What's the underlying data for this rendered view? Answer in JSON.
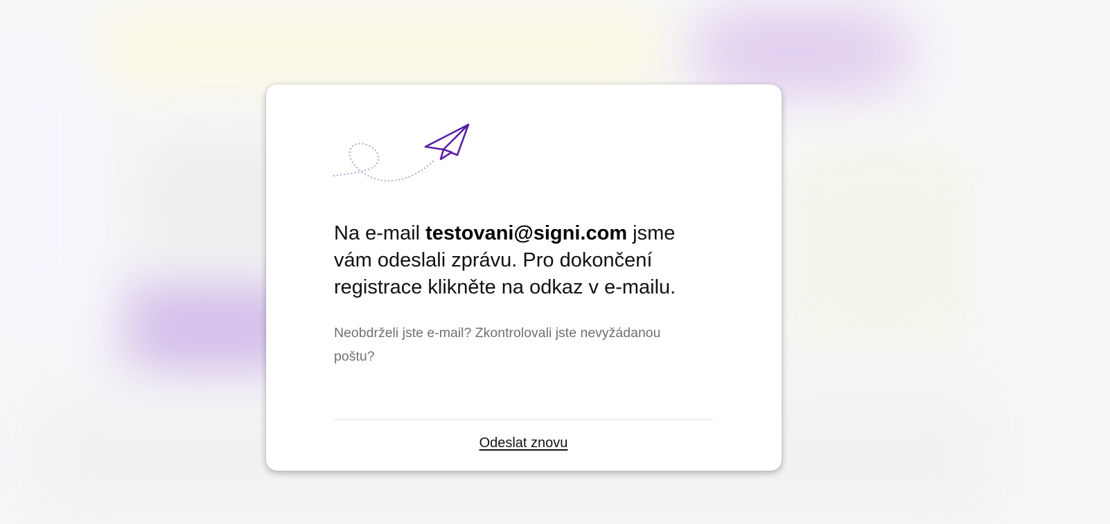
{
  "message": {
    "prefix": "Na e-mail ",
    "email": "testovani@signi.com",
    "suffix": " jsme vám odeslali zprávu. Pro dokončení registrace klikněte na odkaz v e-mailu."
  },
  "hint": "Neobdrželi jste e-mail? Zkontrolovali jste nevyžádanou poštu?",
  "actions": {
    "resend_label": "Odeslat znovu"
  },
  "illustration": {
    "icon": "paper-plane-icon",
    "accent_color": "#5b1fa6",
    "trail_color": "#b9b2d3"
  }
}
